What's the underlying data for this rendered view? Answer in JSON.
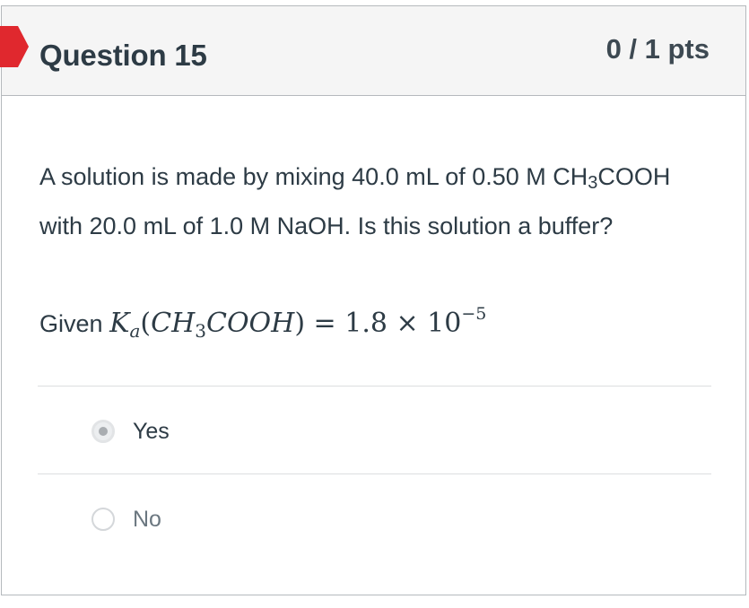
{
  "question": {
    "title": "Question 15",
    "points": "0 / 1 pts",
    "text": "A solution is made by mixing 40.0 mL of 0.50 M CH3COOH with 20.0 mL of 1.0 M NaOH. Is this solution a buffer?",
    "given_prefix": "Given",
    "given_formula": "Ka(CH3COOH) = 1.8 × 10−5",
    "flag_color": "#e0282e",
    "flag_icon": "incorrect-flag-icon"
  },
  "answers": [
    {
      "label": "Yes",
      "selected": true
    },
    {
      "label": "No",
      "selected": false
    }
  ]
}
